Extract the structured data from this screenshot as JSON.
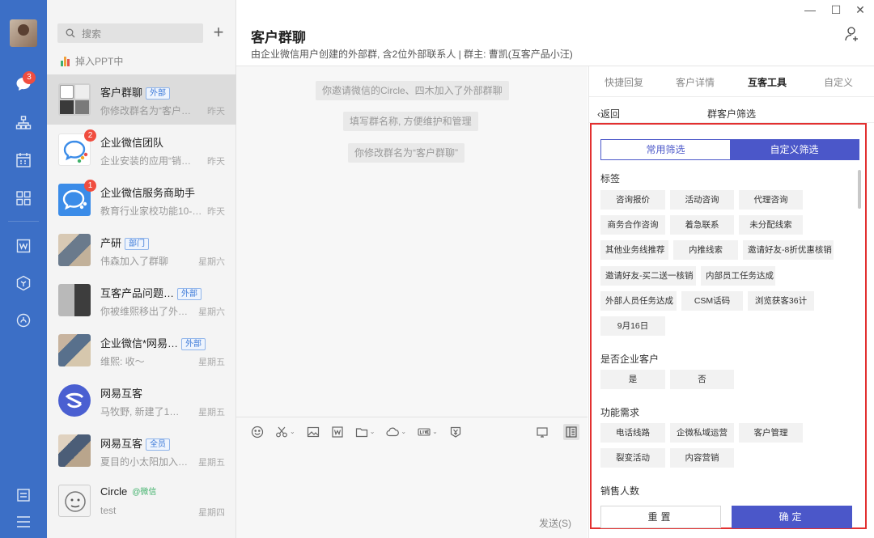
{
  "nav": {
    "badge": "3"
  },
  "list": {
    "search_placeholder": "搜索",
    "plus": "+",
    "ppt_status": "掉入PPT中",
    "items": [
      {
        "name": "客户群聊",
        "tag": "外部",
        "preview": "你修改群名为“客户…",
        "time": "昨天"
      },
      {
        "name": "企业微信团队",
        "tag": "",
        "preview": "企业安装的应用“销…",
        "time": "昨天",
        "badge": "2"
      },
      {
        "name": "企业微信服务商助手",
        "tag": "",
        "preview": "教育行业家校功能10-…",
        "time": "昨天",
        "badge": "1"
      },
      {
        "name": "产研",
        "tag": "部门",
        "preview": "伟森加入了群聊",
        "time": "星期六"
      },
      {
        "name": "互客产品问题…",
        "tag": "外部",
        "preview": "你被维熙移出了外…",
        "time": "星期六"
      },
      {
        "name": "企业微信*网易…",
        "tag": "外部",
        "preview": "维熙: 收～",
        "time": "星期五"
      },
      {
        "name": "网易互客",
        "tag": "",
        "preview": "马牧野, 新建了1…",
        "time": "星期五"
      },
      {
        "name": "网易互客",
        "tag": "全员",
        "preview": "夏目的小太阳加入…",
        "time": "星期五"
      },
      {
        "name": "Circle",
        "tag": "@微信",
        "preview": "test",
        "time": "星期四"
      }
    ]
  },
  "chat": {
    "title": "客户群聊",
    "subtitle": "由企业微信用户创建的外部群, 含2位外部联系人 | 群主: 曹凯(互客产品小汪)",
    "messages": [
      "你邀请微信的Circle、四木加入了外部群聊",
      "填写群名称, 方便维护和管理",
      "你修改群名为“客户群聊”"
    ],
    "send": "发送(S)"
  },
  "window": {
    "minimize": "—",
    "maximize": "☐",
    "close": "✕"
  },
  "panel": {
    "tabs": [
      "快捷回复",
      "客户详情",
      "互客工具",
      "自定义"
    ],
    "back": "返回",
    "title": "群客户筛选",
    "seg_common": "常用筛选",
    "seg_custom": "自定义筛选",
    "sections": {
      "tags": "标签",
      "enterprise": "是否企业客户",
      "needs": "功能需求",
      "sales": "销售人数"
    },
    "tag_chips": [
      "咨询报价",
      "活动咨询",
      "代理咨询",
      "商务合作咨询",
      "着急联系",
      "未分配线索",
      "其他业务线推荐",
      "内推线索",
      "邀请好友-8折优惠核销",
      "邀请好友-买二送一核销",
      "内部员工任务达成",
      "外部人员任务达成",
      "CSM话码",
      "浏览获客36计",
      "9月16日"
    ],
    "enterprise_chips": [
      "是",
      "否"
    ],
    "needs_chips": [
      "电话线路",
      "企微私域运营",
      "客户管理",
      "裂变活动",
      "内容营销"
    ],
    "reset": "重置",
    "confirm": "确定"
  }
}
